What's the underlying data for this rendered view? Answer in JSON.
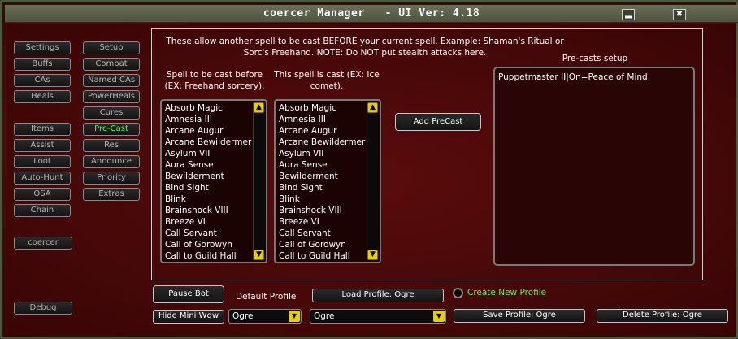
{
  "window": {
    "title": "coercer Manager   - UI Ver: 4.18",
    "min_glyph": "▂",
    "close_glyph": "✖"
  },
  "left_column": [
    "Settings",
    "Buffs",
    "CAs",
    "Heals",
    "Items",
    "Assist",
    "Loot",
    "Auto-Hunt",
    "OSA",
    "Chain"
  ],
  "right_column": [
    "Setup",
    "Combat",
    "Named CAs",
    "PowerHeals",
    "Cures",
    "Pre-Cast",
    "Res",
    "Announce",
    "Priority",
    "Extras"
  ],
  "active_tab": "Pre-Cast",
  "character_button": "coercer",
  "debug_button": "Debug",
  "info_text": "These allow another spell to be cast BEFORE your current spell. Example: Shaman's Ritual or Sorc's Freehand. NOTE: Do NOT put stealth attacks here.",
  "list1_label": "Spell to be cast before (EX: Freehand sorcery).",
  "list2_label": "This spell is cast (EX: Ice comet).",
  "spells": [
    "Absorb Magic",
    "Amnesia III",
    "Arcane Augur",
    "Arcane Bewildermer",
    "Asylum VII",
    "Aura Sense",
    "Bewilderment",
    "Bind Sight",
    "Blink",
    "Brainshock VIII",
    "Breeze VI",
    "Call Servant",
    "Call of Gorowyn",
    "Call to Guild Hall"
  ],
  "add_precast_button": "Add PreCast",
  "precasts_title": "Pre-casts setup",
  "precasts": [
    "Puppetmaster II|On=Peace of Mind"
  ],
  "bottom": {
    "pause_button": "Pause Bot",
    "hide_button": "Hide Mini Wdw",
    "default_profile_label": "Default Profile",
    "default_profile_value": "Ogre",
    "load_profile_button": "Load Profile: Ogre",
    "profile_select_value": "Ogre",
    "create_profile_label": "Create New Profile",
    "save_profile_button": "Save Profile: Ogre",
    "delete_profile_button": "Delete Profile: Ogre"
  },
  "colors": {
    "accent_green": "#4dff4d",
    "scroll_yellow": "#e8d000",
    "background_red": "#4a0a0a"
  }
}
